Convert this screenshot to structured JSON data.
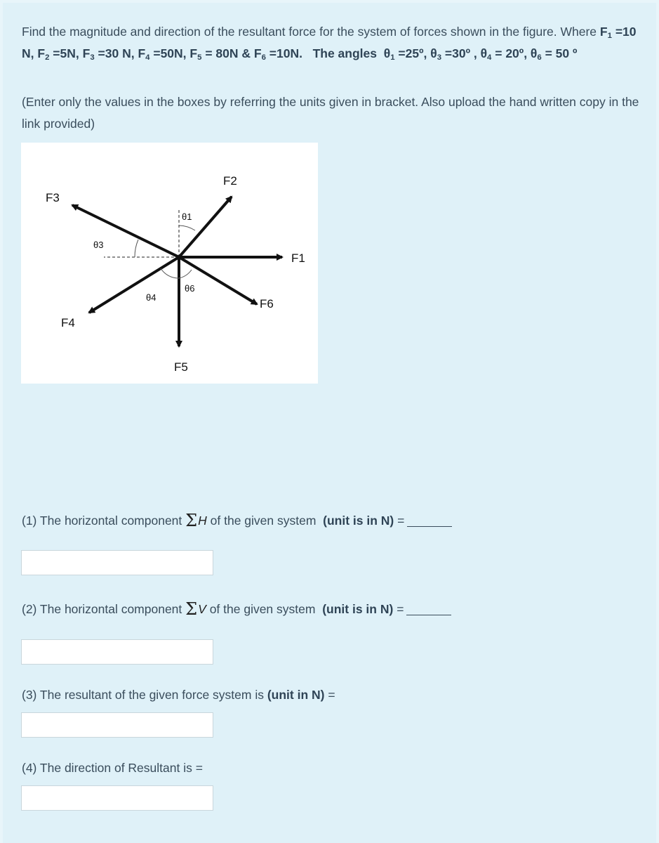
{
  "problem": {
    "intro": "Find the magnitude and direction of the resultant force for the system of forces shown in the figure. Where",
    "forces": [
      {
        "name": "F",
        "sub": "1",
        "value": "=10 N"
      },
      {
        "name": "F",
        "sub": "2",
        "value": "=5N"
      },
      {
        "name": "F",
        "sub": "3",
        "value": "=30 N"
      },
      {
        "name": "F",
        "sub": "4",
        "value": "=50N"
      },
      {
        "name": "F",
        "sub": "5",
        "value": "= 80N"
      },
      {
        "name": "F",
        "sub": "6",
        "value": "=10N."
      }
    ],
    "angles_label": "The angles",
    "angles": [
      {
        "name": "θ",
        "sub": "1",
        "value": "=25º"
      },
      {
        "name": "θ",
        "sub": "3",
        "value": "=30º"
      },
      {
        "name": "θ",
        "sub": "4",
        "value": "= 20º"
      },
      {
        "name": "θ",
        "sub": "6",
        "value": "= 50 º"
      }
    ],
    "instructions": "(Enter only the values in the boxes by referring the units given in bracket.  Also upload the hand written copy in the link provided)"
  },
  "figure": {
    "labels": {
      "F1": "F1",
      "F2": "F2",
      "F3": "F3",
      "F4": "F4",
      "F5": "F5",
      "F6": "F6",
      "t1": "θ1",
      "t3": "θ3",
      "t4": "θ4",
      "t6": "θ6"
    }
  },
  "questions": [
    {
      "prefix": "(1) The horizontal component",
      "symbol": "Σ",
      "var": "H",
      "middle": "of the given system",
      "unit": "(unit is in N)",
      "suffix": "=",
      "answer": ""
    },
    {
      "prefix": "(2) The horizontal component",
      "symbol": "Σ",
      "var": "V",
      "middle": "of the given system",
      "unit": "(unit is in N)",
      "suffix": "=",
      "answer": ""
    },
    {
      "prefix": "(3) The resultant of the given force system is",
      "unit": "(unit in N)",
      "suffix": "=",
      "answer": ""
    },
    {
      "prefix": "(4) The direction of Resultant is =",
      "answer": ""
    }
  ]
}
